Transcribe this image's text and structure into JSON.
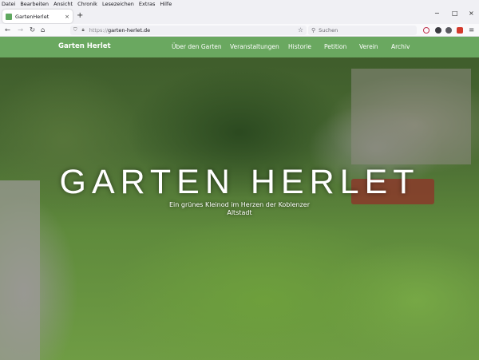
{
  "menubar": {
    "items": [
      "Datei",
      "Bearbeiten",
      "Ansicht",
      "Chronik",
      "Lesezeichen",
      "Extras",
      "Hilfe"
    ]
  },
  "tab": {
    "title": "GartenHerlet",
    "close_glyph": "×"
  },
  "newtab_glyph": "+",
  "window_controls": [
    "−",
    "□",
    "×"
  ],
  "navbar": {
    "url_protocol": "https://",
    "url_host": "garten-herlet.de",
    "search_placeholder": "Suchen"
  },
  "site": {
    "brand": "Garten Herlet",
    "nav": [
      "Über den Garten",
      "Veranstaltungen",
      "Historie",
      "Petition",
      "Verein",
      "Archiv"
    ],
    "hero_title": "GARTEN HERLET",
    "hero_subtitle": "Ein grünes Kleinod im Herzen der Koblenzer Altstadt"
  },
  "colors": {
    "site_nav": "#6aa860",
    "favicon": "#5fa85f"
  },
  "icons": [
    "back-icon",
    "forward-icon",
    "reload-icon",
    "home-icon",
    "shield-icon",
    "lock-icon",
    "bookmark-star-icon",
    "search-icon",
    "pocket-icon",
    "extension-icon",
    "menu-icon"
  ]
}
